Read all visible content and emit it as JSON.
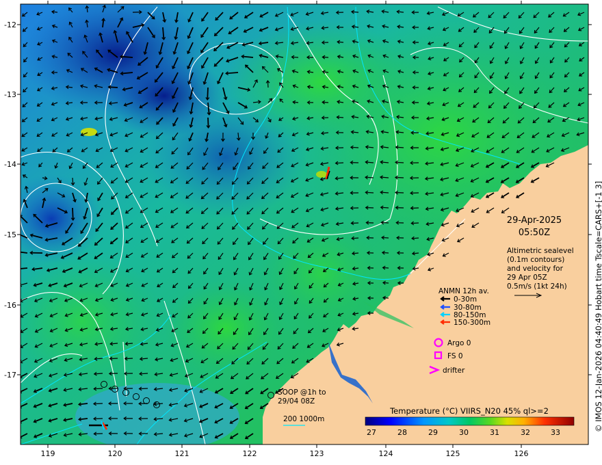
{
  "map": {
    "x_ticks": [
      "119",
      "120",
      "121",
      "122",
      "123",
      "124",
      "125",
      "126"
    ],
    "y_ticks": [
      "-12",
      "-13",
      "-14",
      "-15",
      "-16",
      "-17"
    ]
  },
  "header": {
    "date": "29-Apr-2025",
    "time": "05:50Z"
  },
  "altimetry_note": {
    "lines": [
      "Altimetric sealevel",
      "(0.1m contours)",
      "and velocity for",
      "29 Apr 05Z",
      "0.5m/s (1kt 24h)"
    ]
  },
  "anmn_legend": {
    "title": "ANMN 12h av.",
    "items": [
      {
        "label": "0-30m",
        "color": "#000000"
      },
      {
        "label": "30-80m",
        "color": "#1f4fff"
      },
      {
        "label": "80-150m",
        "color": "#00d2ff"
      },
      {
        "label": "150-300m",
        "color": "#ff2a00"
      }
    ]
  },
  "platforms": {
    "argo": "Argo 0",
    "fs": "FS 0",
    "drifter": "drifter",
    "marker_color": "#ff00ff"
  },
  "soop": {
    "line1": "SOOP @1h to",
    "line2": "29/04 08Z"
  },
  "isobath_legend": {
    "label": "200  1000m"
  },
  "colorbar": {
    "title": "Temperature (°C) VIIRS_N20 45% ql>=2",
    "ticks": [
      "27",
      "28",
      "29",
      "30",
      "31",
      "32",
      "33"
    ],
    "colors": [
      "#00007f",
      "#0000ff",
      "#0080ff",
      "#00c8c8",
      "#00c864",
      "#30d830",
      "#a0e000",
      "#f0e000",
      "#ff8000",
      "#ff2000",
      "#a00000"
    ]
  },
  "credit": "© IMOS 12-Jan-2026 04:40:49 Hobart time Tscale=CARS+[-1 3]",
  "colors": {
    "land": "#f9cf9e",
    "contour": "#ffffff",
    "isobath": "#00e6ff",
    "arrow": "#000000"
  }
}
